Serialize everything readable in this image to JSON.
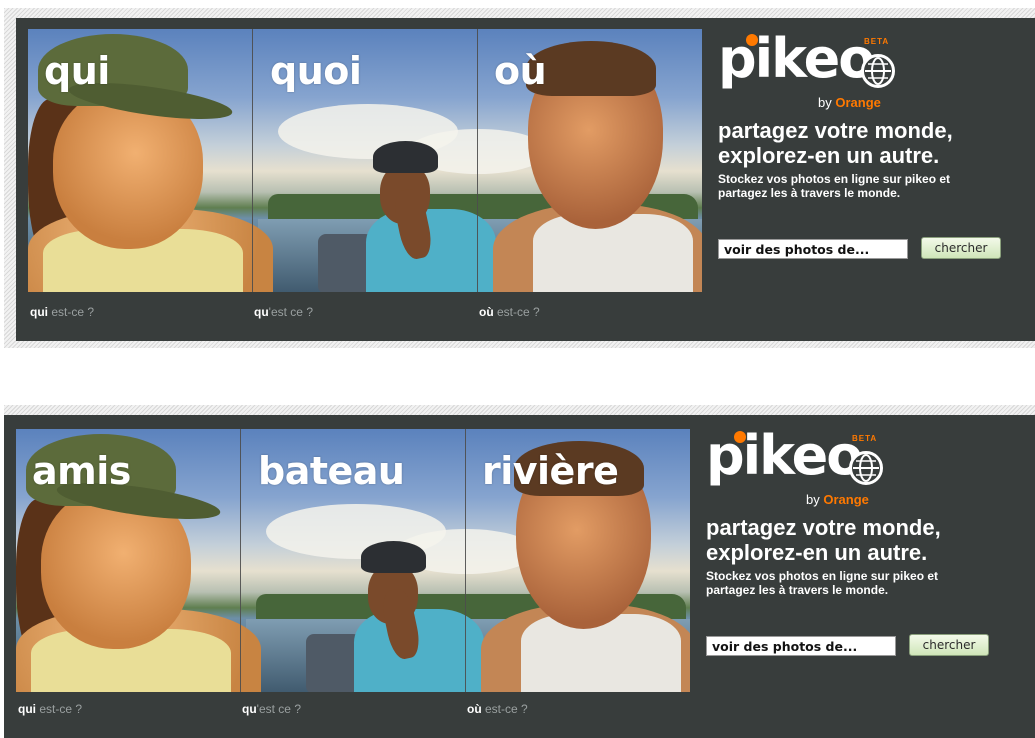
{
  "banners": [
    {
      "photo_labels": [
        "qui",
        "quoi",
        "où"
      ],
      "captions": [
        {
          "strong": "qui",
          "rest": " est-ce ?"
        },
        {
          "strong": "qu",
          "rest": "'est ce ?"
        },
        {
          "strong": "où",
          "rest": " est-ce ?"
        }
      ]
    },
    {
      "photo_labels": [
        "amis",
        "bateau",
        "rivière"
      ],
      "captions": [
        {
          "strong": "qui",
          "rest": " est-ce ?"
        },
        {
          "strong": "qu",
          "rest": "'est ce ?"
        },
        {
          "strong": "où",
          "rest": " est-ce ?"
        }
      ]
    }
  ],
  "brand": {
    "logo": "pikeo",
    "beta": "BETA",
    "by": "by",
    "by_brand": "Orange",
    "headline": "partagez votre monde, explorez-en un autre.",
    "blurb": "Stockez vos photos en ligne sur pikeo et partagez les à travers le monde.",
    "search_value": "voir des photos de...",
    "search_button": "chercher"
  },
  "colors": {
    "banner_bg": "#383d3c",
    "accent": "#ff7900",
    "button_bg": "#cfe6b9"
  }
}
